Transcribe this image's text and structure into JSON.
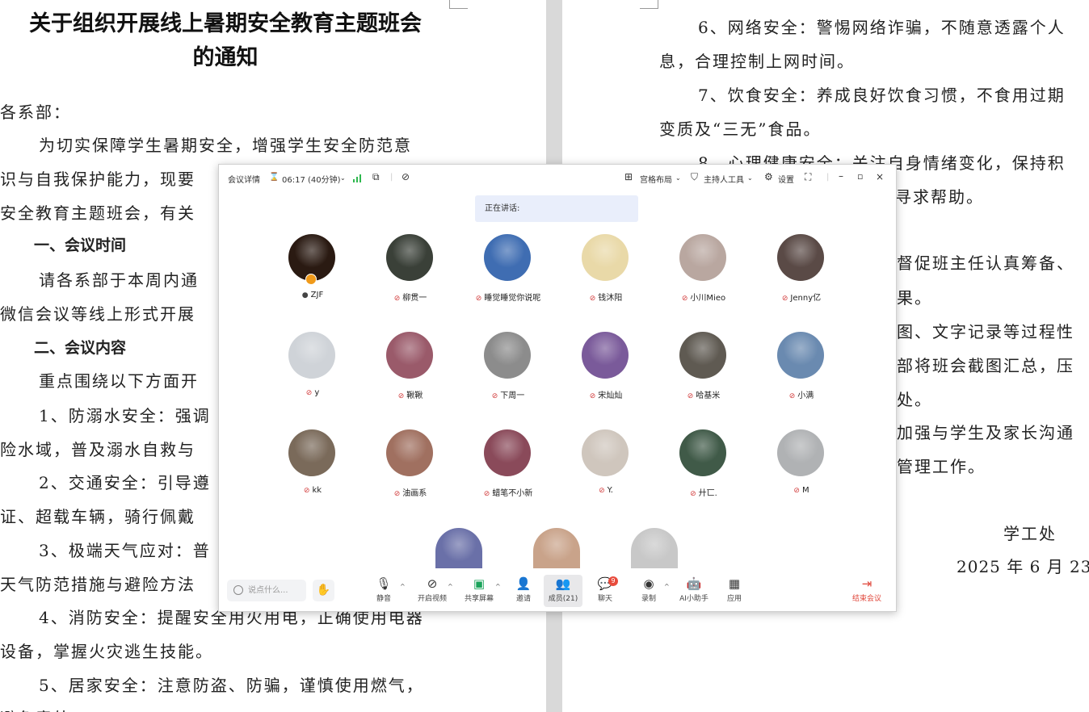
{
  "document": {
    "left": {
      "title_line1": "关于组织开展线上暑期安全教育主题班会",
      "title_line2": "的通知",
      "lines": [
        "各系部：",
        "为切实保障学生暑期安全，增强学生安全防范意",
        "识与自我保护能力，现要",
        "安全教育主题班会，有关",
        "一、会议时间",
        "请各系部于本周内通",
        "微信会议等线上形式开展",
        "二、会议内容",
        "重点围绕以下方面开",
        "1、防溺水安全：强调",
        "险水域，普及溺水自救与",
        "2、交通安全：引导遵",
        "证、超载车辆，骑行佩戴",
        "3、极端天气应对：普",
        "天气防范措施与避险方法",
        "4、消防安全：提醒安全用火用电，正确使用电器",
        "设备，掌握火灾逃生技能。",
        "5、居家安全：注意防盗、防骗，谨慎使用燃气，",
        "避免意外…"
      ]
    },
    "right": {
      "lines": [
        "6、网络安全：警惕网络诈骗，不随意透露个人",
        "息，合理控制上网时间。",
        "7、饮食安全：养成良好饮食习惯，不食用过期",
        "变质及“三无”食品。",
        "8、心理健康安全：关注自身情绪变化，保持积",
        "寻求帮助。",
        "督促班主任认真筹备、",
        "果。",
        "图、文字记录等过程性",
        "部将班会截图汇总，压",
        "处。",
        "加强与学生及家长沟通",
        "管理工作。"
      ],
      "signature": "学工处",
      "date": "2025 年 6 月 23"
    }
  },
  "meeting": {
    "titlebar": {
      "details": "会议详情",
      "timer": "06:17 (40分钟)",
      "layout": "宫格布局",
      "host_tools": "主持人工具",
      "settings": "设置"
    },
    "speaking_label": "正在讲话:",
    "participants": [
      {
        "name": "ZJF",
        "mic": "on",
        "color": "#2a1a12"
      },
      {
        "name": "柳贯一",
        "mic": "off",
        "color": "#3a4038"
      },
      {
        "name": "睡觉睡觉你说呢",
        "mic": "off",
        "color": "#3f6db2"
      },
      {
        "name": "钱沐阳",
        "mic": "off",
        "color": "#e9d9a8"
      },
      {
        "name": "小川Mieo",
        "mic": "off",
        "color": "#b9a7a0"
      },
      {
        "name": "Jenny亿",
        "mic": "off",
        "color": "#5a4a46"
      },
      {
        "name": "y",
        "mic": "off",
        "color": "#cfd3d8"
      },
      {
        "name": "鞦鞦",
        "mic": "off",
        "color": "#9a5a6a"
      },
      {
        "name": "下周一",
        "mic": "off",
        "color": "#8c8c8c"
      },
      {
        "name": "宋灿灿",
        "mic": "off",
        "color": "#7a5a9a"
      },
      {
        "name": "哈基米",
        "mic": "off",
        "color": "#5f5a52"
      },
      {
        "name": "小满",
        "mic": "off",
        "color": "#6a8ab0"
      },
      {
        "name": "kk",
        "mic": "off",
        "color": "#7a6a5a"
      },
      {
        "name": "油画系",
        "mic": "off",
        "color": "#a07060"
      },
      {
        "name": "蜡笔不小新",
        "mic": "off",
        "color": "#8a4a5a"
      },
      {
        "name": "Y.",
        "mic": "off",
        "color": "#cfc6bd"
      },
      {
        "name": "廾匸.",
        "mic": "off",
        "color": "#405a48"
      },
      {
        "name": "M",
        "mic": "off",
        "color": "#b0b2b4"
      }
    ],
    "partial_avatars": [
      {
        "color": "#6a70a8"
      },
      {
        "color": "#c9a38a"
      },
      {
        "color": "#c8c8c8"
      }
    ],
    "toolbar": {
      "chat_placeholder": "说点什么...",
      "mute": "静音",
      "video": "开启视频",
      "share": "共享屏幕",
      "invite": "邀请",
      "members": "成员(21)",
      "chat": "聊天",
      "chat_badge": "9",
      "record": "录制",
      "ai": "AI小助手",
      "apps": "应用",
      "end": "结束会议"
    }
  }
}
